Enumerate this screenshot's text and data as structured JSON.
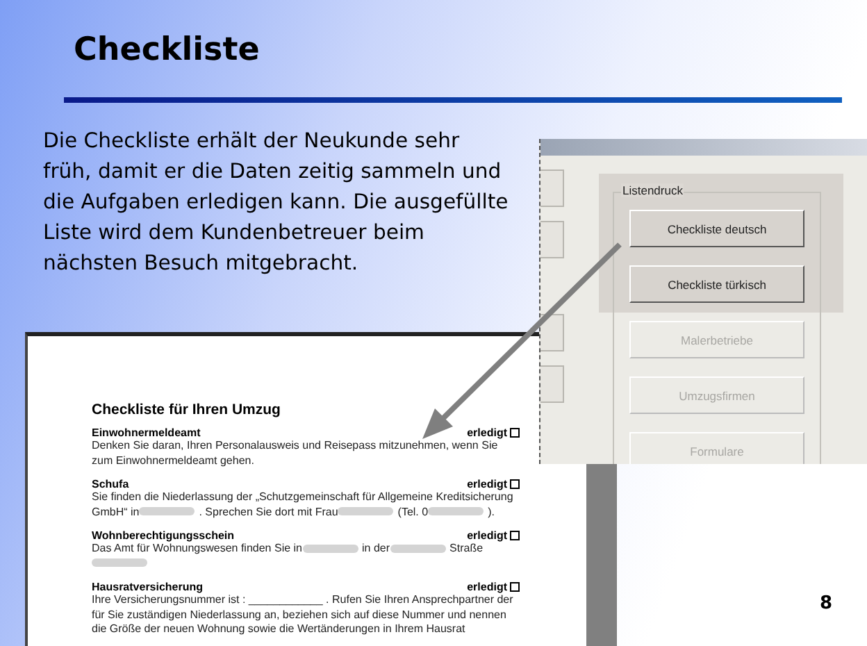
{
  "slide": {
    "title": "Checkliste",
    "body": "Die Checkliste erhält der Neukunde sehr früh, damit er die Daten zeitig sammeln und die Aufgaben erledigen kann. Die ausgefüllte Liste wird dem Kundenbetreuer beim nächsten Besuch mitgebracht.",
    "page_number": "8"
  },
  "program_window": {
    "group_label": "Listendruck",
    "buttons": [
      {
        "label": "Checkliste deutsch",
        "disabled": false
      },
      {
        "label": "Checkliste türkisch",
        "disabled": false
      },
      {
        "label": "Malerbetriebe",
        "disabled": true
      },
      {
        "label": "Umzugsfirmen",
        "disabled": true
      },
      {
        "label": "Formulare",
        "disabled": true
      }
    ]
  },
  "document": {
    "title": "Checkliste für Ihren Umzug",
    "items": [
      {
        "heading": "Einwohnermeldeamt",
        "status": "erledigt",
        "checked": false,
        "segments": [
          {
            "kind": "text",
            "text": "Denken Sie daran, Ihren Personalausweis und Reisepass mitzunehmen, wenn Sie zum Einwohnermeldeamt gehen."
          }
        ]
      },
      {
        "heading": "Schufa",
        "status": "erledigt",
        "checked": false,
        "segments": [
          {
            "kind": "text",
            "text": "Sie finden die Niederlassung der „Schutzgemeinschaft für Allgemeine Kreditsicherung GmbH“ in"
          },
          {
            "kind": "blur"
          },
          {
            "kind": "text",
            "text": ". Sprechen Sie dort mit Frau"
          },
          {
            "kind": "blur"
          },
          {
            "kind": "text",
            "text": "(Tel. 0"
          },
          {
            "kind": "blur"
          },
          {
            "kind": "text",
            "text": ")."
          }
        ]
      },
      {
        "heading": "Wohnberechtigungsschein",
        "status": "erledigt",
        "checked": false,
        "segments": [
          {
            "kind": "text",
            "text": "Das Amt für Wohnungswesen finden Sie in"
          },
          {
            "kind": "blur"
          },
          {
            "kind": "text",
            "text": "in der"
          },
          {
            "kind": "blur"
          },
          {
            "kind": "text",
            "text": "Straße"
          },
          {
            "kind": "blur"
          }
        ]
      },
      {
        "heading": "Hausratversicherung",
        "status": "erledigt",
        "checked": false,
        "segments": [
          {
            "kind": "text",
            "text": "Ihre Versicherungsnummer ist : ____________ . Rufen Sie Ihren Ansprechpartner der für Sie zuständigen Niederlassung an, beziehen sich auf diese Nummer und nennen die Größe der neuen Wohnung sowie die Wertänderungen in Ihrem Hausrat"
          }
        ]
      }
    ]
  }
}
